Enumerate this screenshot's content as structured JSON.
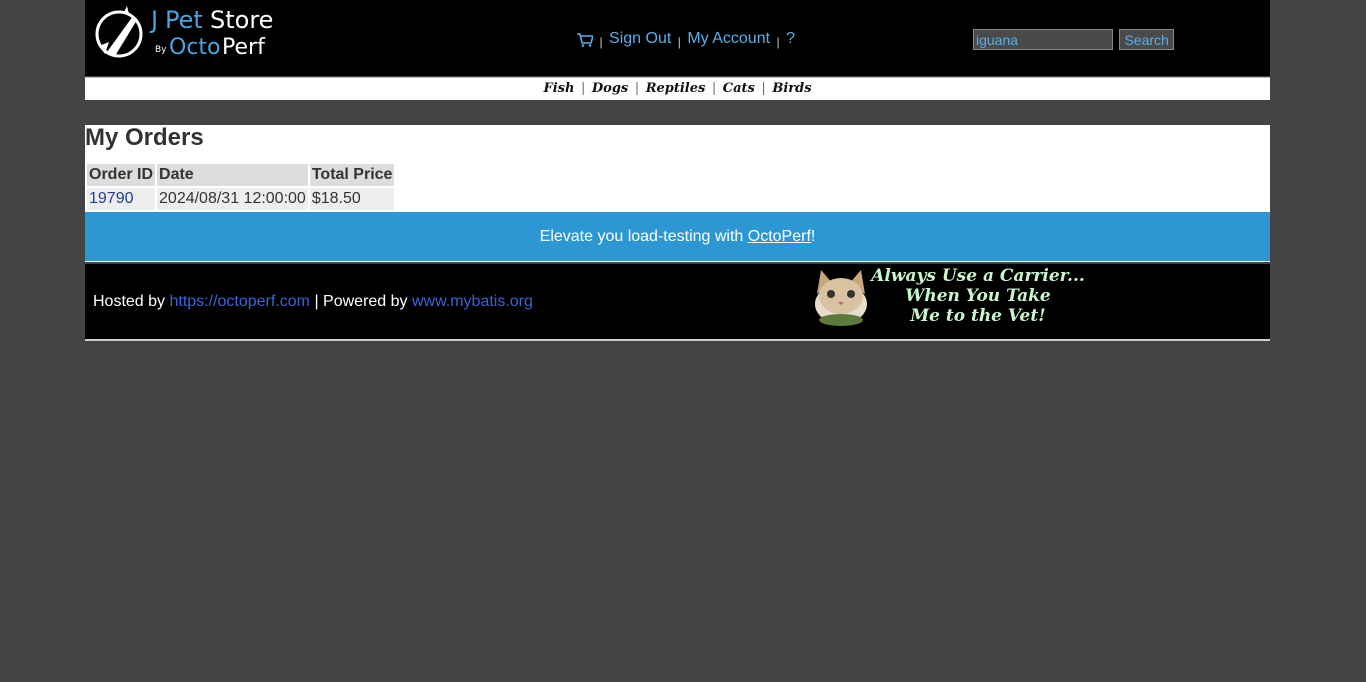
{
  "header": {
    "logo_top": "JPetStore",
    "logo_by": "By",
    "logo_bottom": "OctoPerf",
    "menu": {
      "sign_out": "Sign Out",
      "my_account": "My Account",
      "help": "?",
      "separator": "|"
    },
    "search": {
      "value": "iguana",
      "button_label": "Search"
    }
  },
  "quicklinks": {
    "items": [
      "Fish",
      "Dogs",
      "Reptiles",
      "Cats",
      "Birds"
    ],
    "separator": "|"
  },
  "content": {
    "title": "My Orders",
    "table": {
      "headers": [
        "Order ID",
        "Date",
        "Total Price"
      ],
      "rows": [
        [
          "19790",
          "2024/08/31 12:00:00",
          "$18.50"
        ]
      ]
    }
  },
  "poweredby": {
    "text_before": "Elevate you load-testing with ",
    "link": "OctoPerf",
    "text_after": "!"
  },
  "footer": {
    "hosted_by": "Hosted by ",
    "hosted_link": "https://octoperf.com",
    "powered_by": " | Powered by ",
    "powered_link": "www.mybatis.org",
    "banner_line1": "Always Use a Carrier...",
    "banner_line2": "When You Take",
    "banner_line3": "Me to the Vet!"
  },
  "colors": {
    "page_bg": "#444444",
    "link_blue": "#5aaee8",
    "accent_bar": "#2d97d3"
  }
}
